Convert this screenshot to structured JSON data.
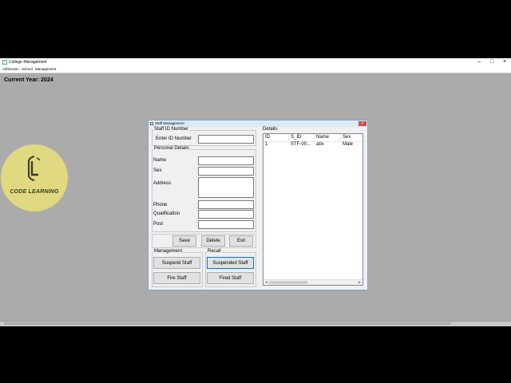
{
  "window": {
    "title": "College Management",
    "minimize_glyph": "–",
    "maximize_glyph": "□",
    "close_glyph": "×"
  },
  "menu": [
    "Admission",
    "School",
    "Management"
  ],
  "current_year": "Current Year: 2024",
  "logo": {
    "letter": "L",
    "text": "CODE LEARNING"
  },
  "dialog": {
    "title": "Staff Management",
    "close_glyph": "×",
    "staff_id_group": "Staff ID Number",
    "enter_id_label": "Enter ID Number",
    "personal_group": "Personal Details",
    "fields": {
      "name": "Name",
      "sex": "Sex",
      "address": "Address",
      "phone": "Phone",
      "qualification": "Qualification",
      "post": "Post"
    },
    "buttons": {
      "save": "Save",
      "delete": "Delete",
      "exit": "Exit"
    },
    "management_group": "Management",
    "recall_group": "Recall",
    "suspend_staff": "Suspend Staff",
    "fire_staff": "Fire Staff",
    "suspended_staff": "Suspended Staff",
    "fired_staff": "Fired Staff",
    "details_group": "Details",
    "table": {
      "columns": [
        "ID",
        "S_ID",
        "Name",
        "Sex"
      ],
      "rows": [
        {
          "id": "1",
          "s_id": "STF-00...",
          "name": "abx",
          "sex": "Male"
        }
      ],
      "scroll_left": "◂",
      "scroll_right": "▸"
    }
  }
}
